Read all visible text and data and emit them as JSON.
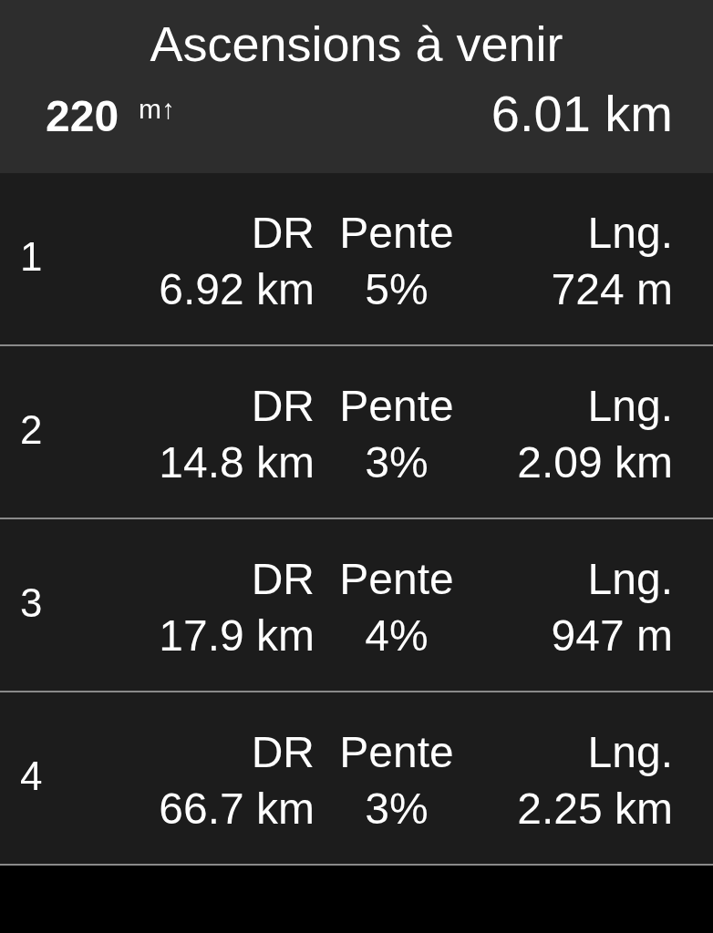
{
  "header": {
    "title": "Ascensions à venir",
    "ascent_value": "220",
    "ascent_unit": "m↑",
    "distance": "6.01 km"
  },
  "climbs": [
    {
      "number": "1",
      "labels": [
        "DR",
        "Pente",
        "Lng."
      ],
      "values": [
        "6.92 km",
        "5%",
        "724 m"
      ]
    },
    {
      "number": "2",
      "labels": [
        "DR",
        "Pente",
        "Lng."
      ],
      "values": [
        "14.8 km",
        "3%",
        "2.09 km"
      ]
    },
    {
      "number": "3",
      "labels": [
        "DR",
        "Pente",
        "Lng."
      ],
      "values": [
        "17.9 km",
        "4%",
        "947 m"
      ]
    },
    {
      "number": "4",
      "labels": [
        "DR",
        "Pente",
        "Lng."
      ],
      "values": [
        "66.7 km",
        "3%",
        "2.25 km"
      ]
    }
  ]
}
